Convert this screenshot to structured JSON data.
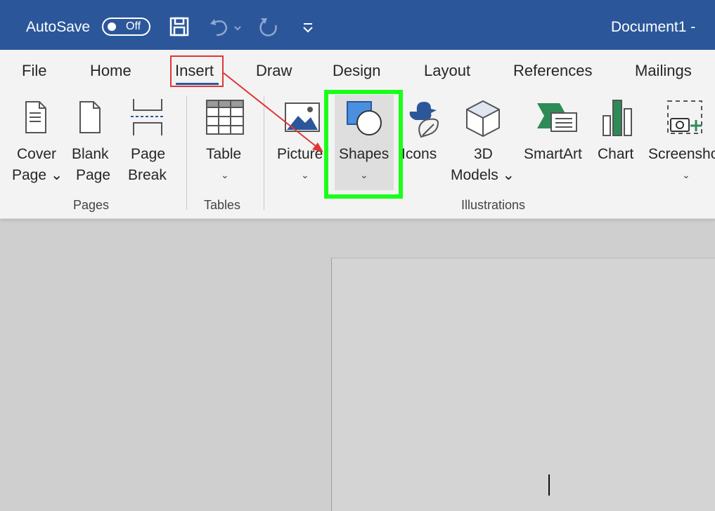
{
  "title_bar": {
    "autosave_label": "AutoSave",
    "autosave_state": "Off",
    "document_title": "Document1  -"
  },
  "tabs": [
    "File",
    "Home",
    "Insert",
    "Draw",
    "Design",
    "Layout",
    "References",
    "Mailings"
  ],
  "active_tab": "Insert",
  "ribbon": {
    "pages": {
      "group_label": "Pages",
      "cover_page": [
        "Cover",
        "Page ⌄"
      ],
      "blank_page": [
        "Blank",
        "Page"
      ],
      "page_break": [
        "Page",
        "Break"
      ]
    },
    "tables": {
      "group_label": "Tables",
      "table": "Table"
    },
    "illustrations": {
      "group_label": "Illustrations",
      "pictures": "Picture",
      "shapes": "Shapes",
      "icons": "Icons",
      "models_3d": [
        "3D",
        "Models ⌄"
      ],
      "smartart": "SmartArt",
      "chart": "Chart",
      "screenshot": "Screensho"
    }
  },
  "colors": {
    "title_bar": "#2b579a",
    "ribbon": "#f3f3f3",
    "highlight_green": "#19ff19",
    "highlight_red": "#e03535",
    "workspace": "#cfcfcf"
  }
}
